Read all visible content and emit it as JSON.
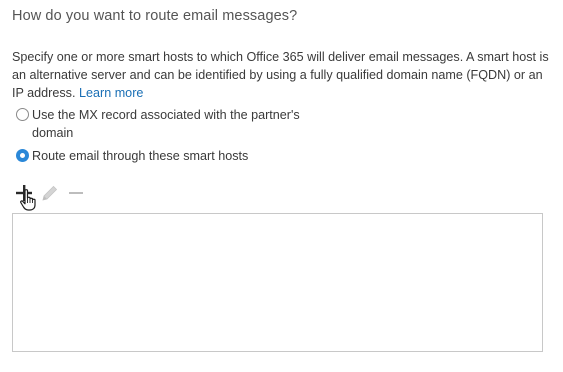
{
  "section": {
    "heading": "How do you want to route email messages?",
    "description": "Specify one or more smart hosts to which Office 365 will deliver email messages. A smart host is an alternative server and can be identified by using a fully qualified domain name (FQDN) or an IP address.",
    "learn_more": "Learn more"
  },
  "routing_options": [
    {
      "label": "Use the MX record associated with the partner's domain",
      "selected": false
    },
    {
      "label": "Route email through these smart hosts",
      "selected": true
    }
  ],
  "toolbar": {
    "icons": [
      "add-icon",
      "edit-icon",
      "remove-icon"
    ]
  },
  "smart_hosts": [],
  "colors": {
    "accent": "#2b88d8",
    "link": "#1a6fb5"
  }
}
